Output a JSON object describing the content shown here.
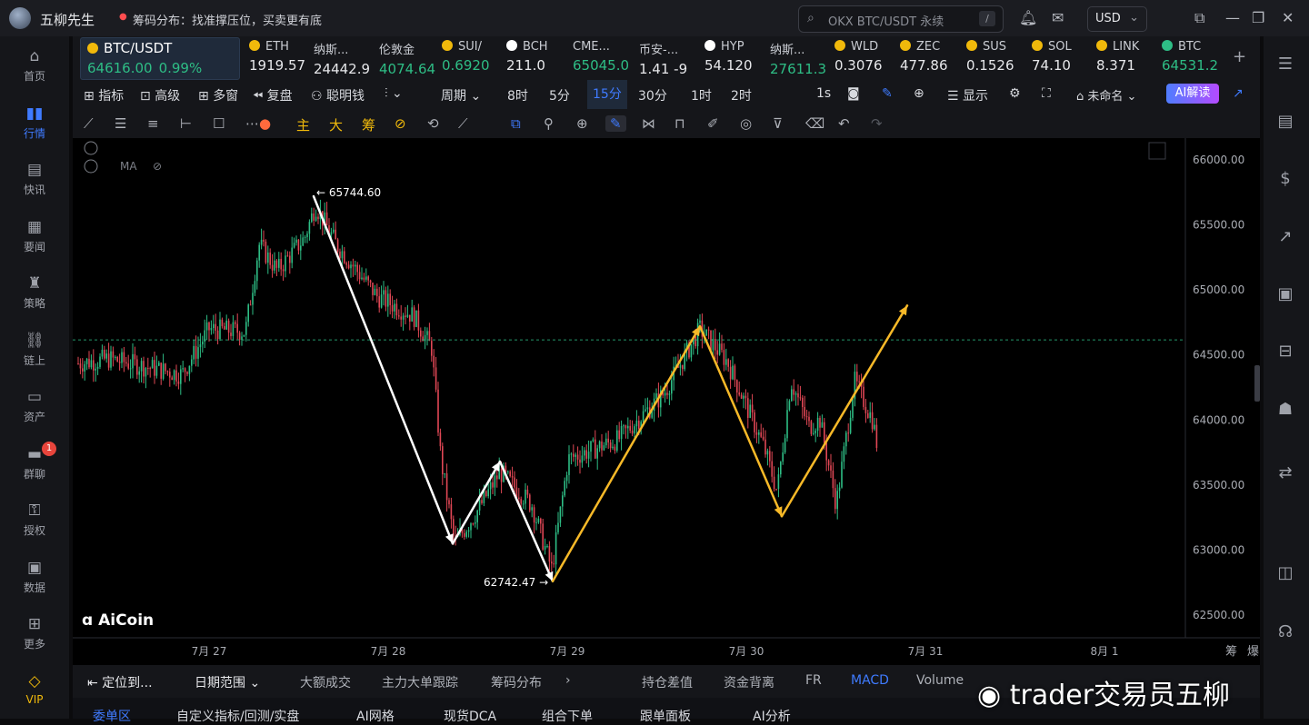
{
  "app": {
    "title": "五柳先生",
    "notice": "筹码分布：找准撑压位，买卖更有底",
    "search_placeholder": "OKX BTC/USDT 永续",
    "search_shortcut": "/",
    "currency": "USD"
  },
  "left_nav": [
    {
      "label": "首页",
      "icon": "home-icon"
    },
    {
      "label": "行情",
      "icon": "market-icon",
      "active": true
    },
    {
      "label": "快讯",
      "icon": "news-flash-icon"
    },
    {
      "label": "要闻",
      "icon": "headline-icon"
    },
    {
      "label": "策略",
      "icon": "strategy-icon"
    },
    {
      "label": "链上",
      "icon": "onchain-icon"
    },
    {
      "label": "资产",
      "icon": "wallet-icon"
    },
    {
      "label": "群聊",
      "icon": "chat-icon",
      "badge": "1"
    },
    {
      "label": "授权",
      "icon": "key-icon"
    },
    {
      "label": "数据",
      "icon": "data-icon"
    },
    {
      "label": "更多",
      "icon": "more-icon"
    },
    {
      "label": "VIP",
      "icon": "vip-icon"
    }
  ],
  "tickers": [
    {
      "name": "BTC/USDT",
      "price": "64616.00",
      "change": "0.99%",
      "color": "#f0b90b"
    },
    {
      "name": "ETH",
      "price": "1919.57",
      "color": "#f0b90b"
    },
    {
      "name": "纳斯...",
      "price": "24442.9"
    },
    {
      "name": "伦敦金",
      "price": "4074.64"
    },
    {
      "name": "SUI/",
      "price": "0.6920",
      "color": "#f0b90b"
    },
    {
      "name": "BCH",
      "price": "211.0",
      "color": "#ffffff"
    },
    {
      "name": "CME...",
      "price": "65045.0"
    },
    {
      "name": "币安-...",
      "price": "1.41 -9"
    },
    {
      "name": "HYP",
      "price": "54.120",
      "color": "#ffffff"
    },
    {
      "name": "纳斯...",
      "price": "27611.3"
    },
    {
      "name": "WLD",
      "price": "0.3076",
      "color": "#f0b90b"
    },
    {
      "name": "ZEC",
      "price": "477.86",
      "color": "#f0b90b"
    },
    {
      "name": "SUS",
      "price": "0.1526",
      "color": "#f0b90b"
    },
    {
      "name": "SOL",
      "price": "74.10",
      "color": "#f0b90b"
    },
    {
      "name": "LINK",
      "price": "8.371",
      "color": "#f0b90b"
    },
    {
      "name": "BTC",
      "price": "64531.2",
      "color": "#2ebd85"
    }
  ],
  "toolbar": {
    "indicators": "指标",
    "advanced": "高级",
    "multi": "多窗",
    "replay": "复盘",
    "smart": "聪明钱",
    "period": "周期",
    "intervals": [
      "8时",
      "5分",
      "15分",
      "30分",
      "1时",
      "2时"
    ],
    "active_interval": "15分",
    "sec": "1s",
    "display": "显示",
    "layout_name": "未命名",
    "ai": "AI解读"
  },
  "drawing_tools": {
    "main": "主",
    "big": "大",
    "chips": "筹"
  },
  "chart_data": {
    "type": "candlestick",
    "symbol": "BTC/USDT",
    "interval": "15m",
    "y_ticks": [
      "66000.00",
      "65500.00",
      "65000.00",
      "64500.00",
      "64000.00",
      "63500.00",
      "63000.00",
      "62500.00"
    ],
    "ylim": [
      62500,
      66000
    ],
    "x_ticks": [
      "7月 27",
      "7月 28",
      "7月 29",
      "7月 30",
      "7月 31",
      "8月 1"
    ],
    "current_price": 64616,
    "high_label": "65744.60",
    "low_label": "62742.47",
    "indicator_label": "MA",
    "logo": "AiCoin",
    "white_path": [
      65720,
      63050,
      63680,
      62760
    ],
    "orange_path": [
      62760,
      64720,
      63260,
      64880
    ],
    "right_labels": [
      "筹",
      "爆"
    ]
  },
  "bottom_bar": {
    "locate": "定位到...",
    "date_range": "日期范围",
    "items": [
      "大额成交",
      "主力大单跟踪",
      "筹码分布"
    ],
    "right_items": [
      "持仓差值",
      "资金背离",
      "FR",
      "MACD",
      "Volume"
    ],
    "active": "MACD"
  },
  "bottom_tabs": [
    "委单区",
    "自定义指标/回测/实盘",
    "AI网格",
    "现货DCA",
    "组合下单",
    "跟单面板",
    "AI分析"
  ],
  "watermark": "trader交易员五柳"
}
